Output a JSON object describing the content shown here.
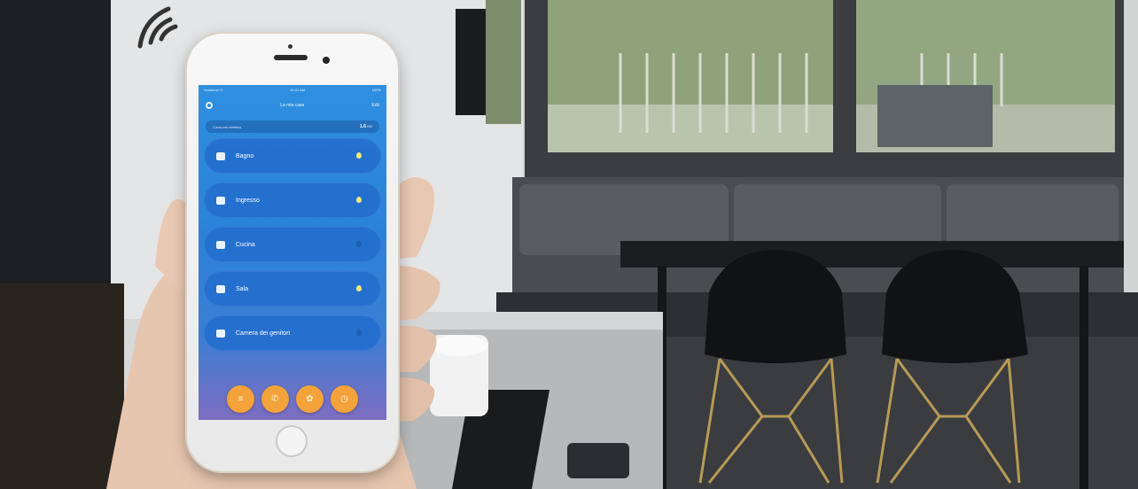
{
  "phone_app": {
    "status_carrier": "Vodafone IT",
    "status_time": "10:41 AM",
    "status_battery": "100%",
    "header_title": "La mia casa",
    "header_edit": "Edit",
    "summary_label": "Consumo elettrico",
    "summary_value": "1.6",
    "summary_unit": "kW",
    "rooms": [
      {
        "label": "Bagno",
        "icon": "bath-icon",
        "active": true
      },
      {
        "label": "Ingresso",
        "icon": "door-icon",
        "active": true
      },
      {
        "label": "Cucina",
        "icon": "pot-icon",
        "active": false
      },
      {
        "label": "Sala",
        "icon": "sofa-icon",
        "active": true
      },
      {
        "label": "Camera dei genitori",
        "icon": "bed-icon",
        "active": false
      }
    ],
    "dock": [
      "menu-icon",
      "phone-icon",
      "leaf-icon",
      "clock-icon"
    ],
    "accent": "#f4a33a",
    "drop_on": "#f6e97a",
    "drop_off": "#1f5fb0"
  }
}
